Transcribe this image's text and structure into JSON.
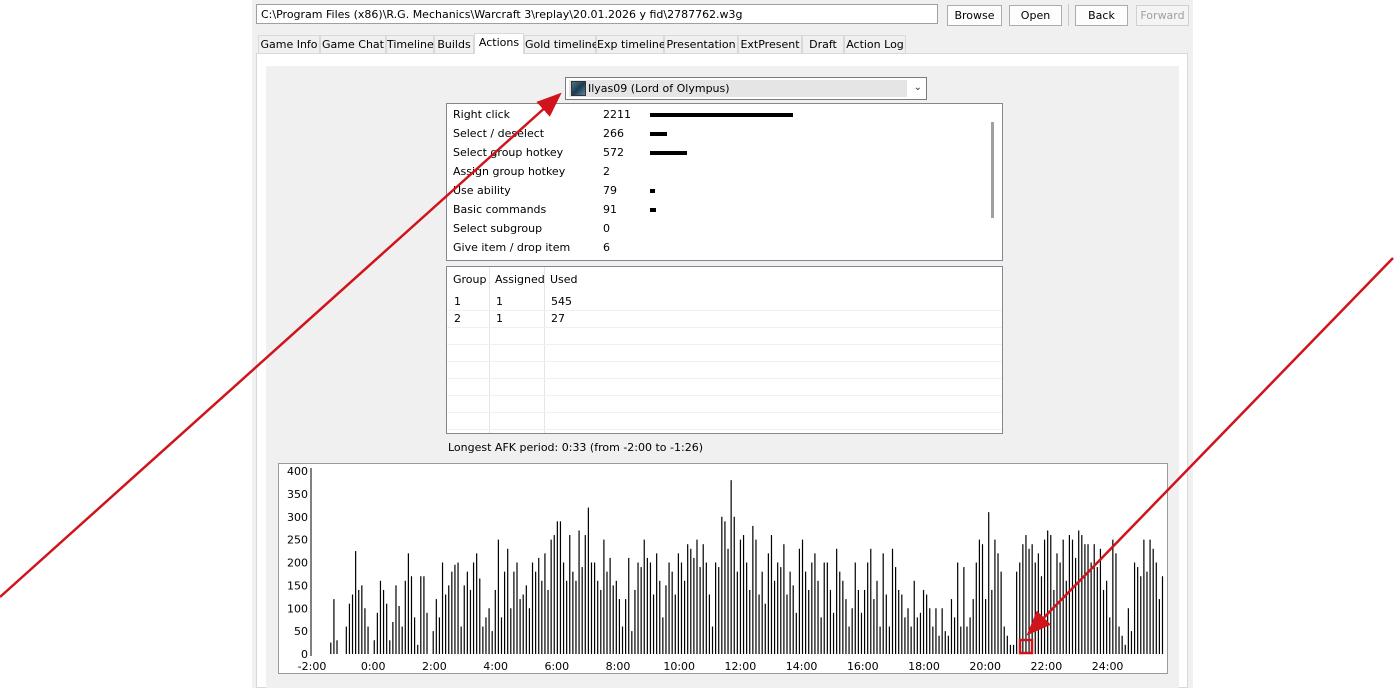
{
  "toolbar": {
    "path": "C:\\Program Files (x86)\\R.G. Mechanics\\Warcraft 3\\replay\\20.01.2026 y fid\\2787762.w3g",
    "browse": "Browse",
    "open": "Open",
    "back": "Back",
    "forward": "Forward"
  },
  "tabs": [
    "Game Info",
    "Game Chat",
    "Timeline",
    "Builds",
    "Actions",
    "Gold timeline",
    "Exp timeline",
    "Presentation",
    "ExtPresent",
    "Draft",
    "Action Log"
  ],
  "active_tab": "Actions",
  "player_select": {
    "value": "Ilyas09 (Lord of Olympus)",
    "icon": "hero-portrait-icon"
  },
  "actions": [
    {
      "name": "Right click",
      "count": "2211",
      "value": 2211
    },
    {
      "name": "Select / deselect",
      "count": "266",
      "value": 266
    },
    {
      "name": "Select group hotkey",
      "count": "572",
      "value": 572
    },
    {
      "name": "Assign group hotkey",
      "count": "2",
      "value": 2
    },
    {
      "name": "Use ability",
      "count": "79",
      "value": 79
    },
    {
      "name": "Basic commands",
      "count": "91",
      "value": 91
    },
    {
      "name": "Select subgroup",
      "count": "0",
      "value": 0
    },
    {
      "name": "Give item / drop item",
      "count": "6",
      "value": 6
    }
  ],
  "groups": {
    "headers": [
      "Group",
      "Assigned",
      "Used"
    ],
    "rows": [
      [
        "1",
        "1",
        "545"
      ],
      [
        "2",
        "1",
        "27"
      ]
    ]
  },
  "afk_text": "Longest AFK period: 0:33 (from -2:00 to -1:26)",
  "colors": {
    "annotation": "#d0141c",
    "bar": "#000000",
    "tab_bg": "#f0f0f0"
  },
  "chart_data": {
    "type": "bar",
    "title": "",
    "xlabel": "",
    "ylabel": "",
    "ylim": [
      0,
      400
    ],
    "xlim_minutes": [
      -2,
      26.5
    ],
    "yticks": [
      "0",
      "50",
      "100",
      "150",
      "200",
      "250",
      "300",
      "350",
      "400"
    ],
    "xticks": [
      "-2:00",
      "0:00",
      "2:00",
      "4:00",
      "6:00",
      "8:00",
      "10:00",
      "12:00",
      "14:00",
      "16:00",
      "18:00",
      "20:00",
      "22:00",
      "24:00"
    ],
    "xtick_minutes": [
      -2,
      0,
      2,
      4,
      6,
      8,
      10,
      12,
      14,
      16,
      18,
      20,
      22,
      24
    ],
    "values": [
      0,
      0,
      25,
      120,
      30,
      0,
      0,
      60,
      110,
      130,
      225,
      140,
      150,
      100,
      60,
      0,
      30,
      90,
      160,
      140,
      110,
      30,
      70,
      150,
      105,
      60,
      160,
      220,
      170,
      80,
      20,
      170,
      170,
      90,
      0,
      50,
      120,
      80,
      200,
      130,
      150,
      180,
      195,
      200,
      60,
      150,
      180,
      140,
      200,
      220,
      165,
      60,
      80,
      100,
      50,
      140,
      250,
      80,
      180,
      230,
      100,
      180,
      200,
      120,
      130,
      150,
      100,
      200,
      180,
      210,
      160,
      220,
      140,
      250,
      260,
      290,
      290,
      200,
      160,
      260,
      180,
      160,
      270,
      190,
      260,
      320,
      200,
      200,
      160,
      140,
      250,
      180,
      210,
      150,
      160,
      120,
      60,
      120,
      210,
      50,
      140,
      200,
      190,
      250,
      210,
      200,
      130,
      220,
      160,
      80,
      150,
      200,
      180,
      130,
      220,
      200,
      160,
      240,
      230,
      210,
      250,
      190,
      240,
      200,
      130,
      60,
      200,
      190,
      300,
      290,
      230,
      380,
      300,
      180,
      250,
      260,
      200,
      140,
      280,
      250,
      130,
      180,
      110,
      220,
      260,
      160,
      200,
      190,
      240,
      130,
      180,
      150,
      90,
      230,
      250,
      180,
      140,
      200,
      220,
      160,
      80,
      200,
      200,
      140,
      90,
      230,
      180,
      160,
      120,
      60,
      100,
      200,
      140,
      90,
      140,
      200,
      230,
      120,
      160,
      60,
      220,
      130,
      60,
      230,
      190,
      140,
      130,
      80,
      100,
      60,
      160,
      80,
      90,
      140,
      130,
      100,
      60,
      100,
      40,
      100,
      50,
      40,
      120,
      80,
      200,
      60,
      190,
      60,
      80,
      120,
      200,
      250,
      240,
      120,
      310,
      140,
      250,
      220,
      180,
      60,
      40,
      20,
      20,
      180,
      200,
      240,
      260,
      230,
      240,
      200,
      220,
      170,
      250,
      270,
      260,
      140,
      220,
      200,
      250,
      160,
      260,
      250,
      210,
      270,
      260,
      240,
      240,
      200,
      240,
      190,
      230,
      140,
      160,
      80,
      250,
      220,
      60,
      40,
      20,
      100,
      50,
      200,
      190,
      170,
      250,
      180,
      250,
      230,
      200,
      120,
      170
    ]
  },
  "annotations": [
    {
      "type": "arrow",
      "label": "arrow-to-player-dropdown"
    },
    {
      "type": "arrow",
      "label": "arrow-to-chart-highlight"
    },
    {
      "type": "box",
      "label": "highlight-box-21min"
    }
  ]
}
